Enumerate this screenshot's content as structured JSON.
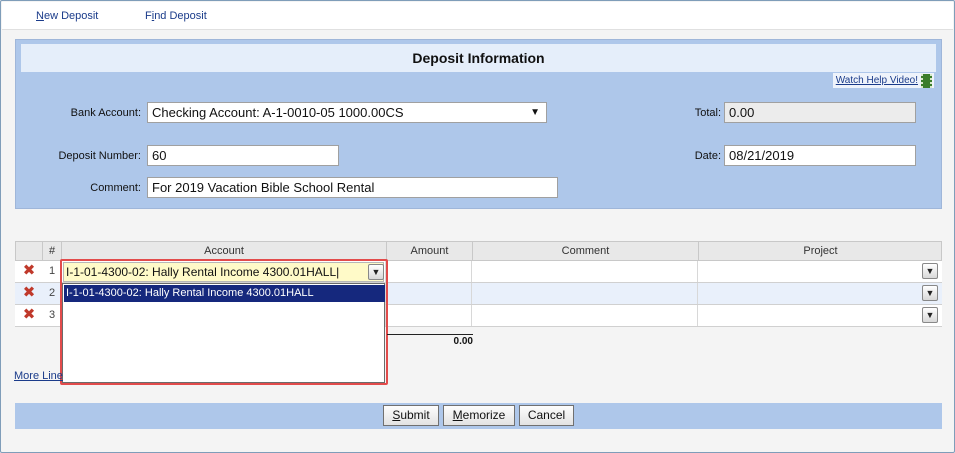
{
  "topnav": {
    "new_deposit_u": "N",
    "new_deposit_rest": "ew Deposit",
    "find_deposit_pre": "F",
    "find_deposit_u": "i",
    "find_deposit_rest": "nd Deposit"
  },
  "deposit_info": {
    "title": "Deposit Information",
    "help_link": "Watch Help Video!",
    "bank_account_label": "Bank Account:",
    "bank_account_value": "Checking Account: A-1-0010-05 1000.00CS",
    "total_label": "Total:",
    "total_value": "0.00",
    "deposit_number_label": "Deposit Number:",
    "deposit_number_value": "60",
    "date_label": "Date:",
    "date_value": "08/21/2019",
    "comment_label": "Comment:",
    "comment_value": "For 2019 Vacation Bible School Rental"
  },
  "grid": {
    "columns": [
      "#",
      "Account",
      "Amount",
      "Comment",
      "Project"
    ],
    "rows": [
      {
        "num": "1",
        "account": "I-1-01-4300-02: Hally Rental Income 4300.01HALL|"
      },
      {
        "num": "2",
        "account": ""
      },
      {
        "num": "3",
        "account": ""
      }
    ],
    "dropdown_option": "I-1-01-4300-02: Hally Rental Income 4300.01HALL",
    "amount_total": "0.00",
    "more_lines": "More Line"
  },
  "buttons": {
    "submit_u": "S",
    "submit_rest": "ubmit",
    "memorize_u": "M",
    "memorize_rest": "emorize",
    "cancel": "Cancel"
  },
  "colors": {
    "panel": "#aec7ea",
    "selected_option": "#15287d",
    "highlight_box": "#e24b4b",
    "delete_icon": "#c0392b"
  },
  "icons": {
    "delete": "red-x",
    "help": "film-strip",
    "dropdown": "chevron-down"
  }
}
